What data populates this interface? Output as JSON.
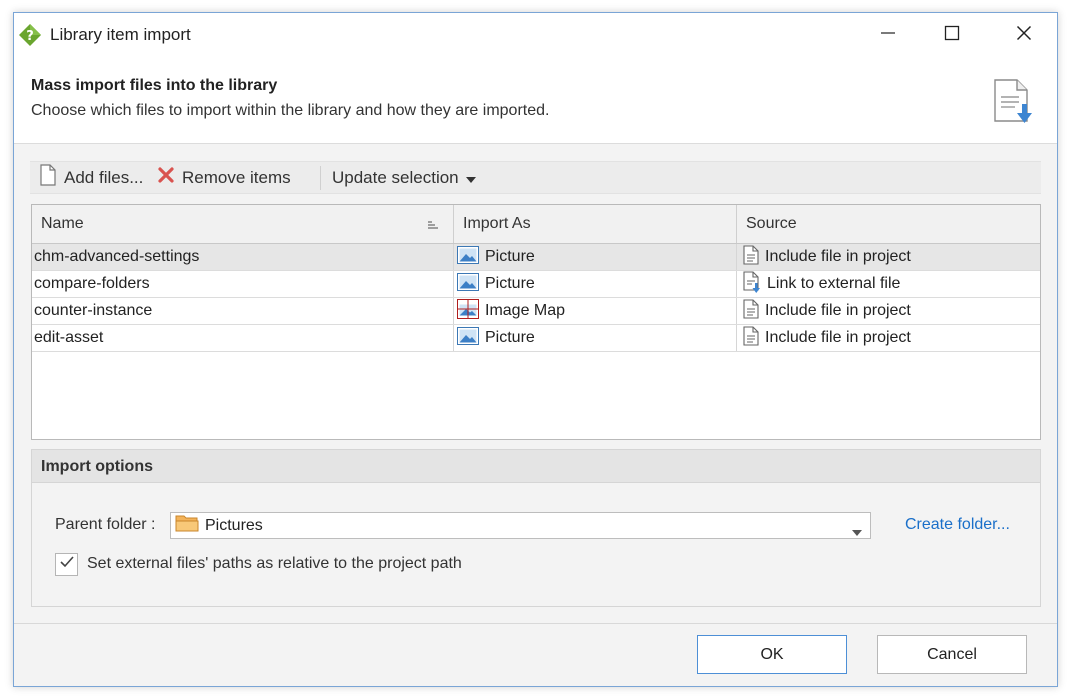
{
  "window": {
    "title": "Library item import",
    "app_icon": "help-diamond-icon",
    "controls": [
      "minimize-icon",
      "maximize-icon",
      "close-icon"
    ]
  },
  "header": {
    "title": "Mass import files into the library",
    "description": "Choose which files to import within the library and how they are imported.",
    "icon": "document-import-icon"
  },
  "toolbar": {
    "add_label": "Add files...",
    "remove_label": "Remove items",
    "update_label": "Update selection"
  },
  "grid": {
    "columns": {
      "name": "Name",
      "import_as": "Import As",
      "source": "Source"
    },
    "rows": [
      {
        "name": "chm-advanced-settings",
        "import_as": "Picture",
        "import_icon": "picture-icon",
        "source": "Include file in project",
        "source_icon": "document-icon",
        "selected": true
      },
      {
        "name": "compare-folders",
        "import_as": "Picture",
        "import_icon": "picture-icon",
        "source": "Link to external file",
        "source_icon": "document-link-icon",
        "selected": false
      },
      {
        "name": "counter-instance",
        "import_as": "Image Map",
        "import_icon": "image-map-icon",
        "source": "Include file in project",
        "source_icon": "document-icon",
        "selected": false
      },
      {
        "name": "edit-asset",
        "import_as": "Picture",
        "import_icon": "picture-icon",
        "source": "Include file in project",
        "source_icon": "document-icon",
        "selected": false
      }
    ]
  },
  "options": {
    "title": "Import options",
    "parent_folder_label": "Parent folder :",
    "parent_folder_value": "Pictures",
    "create_folder_link": "Create folder...",
    "relative_paths_label": "Set external files' paths as relative to the project path",
    "relative_paths_checked": true
  },
  "buttons": {
    "ok": "OK",
    "cancel": "Cancel"
  },
  "colors": {
    "accent": "#4d8fd6",
    "link": "#1a6fc9",
    "remove_red": "#d9534f",
    "app_icon_green": "#6aa52f"
  }
}
